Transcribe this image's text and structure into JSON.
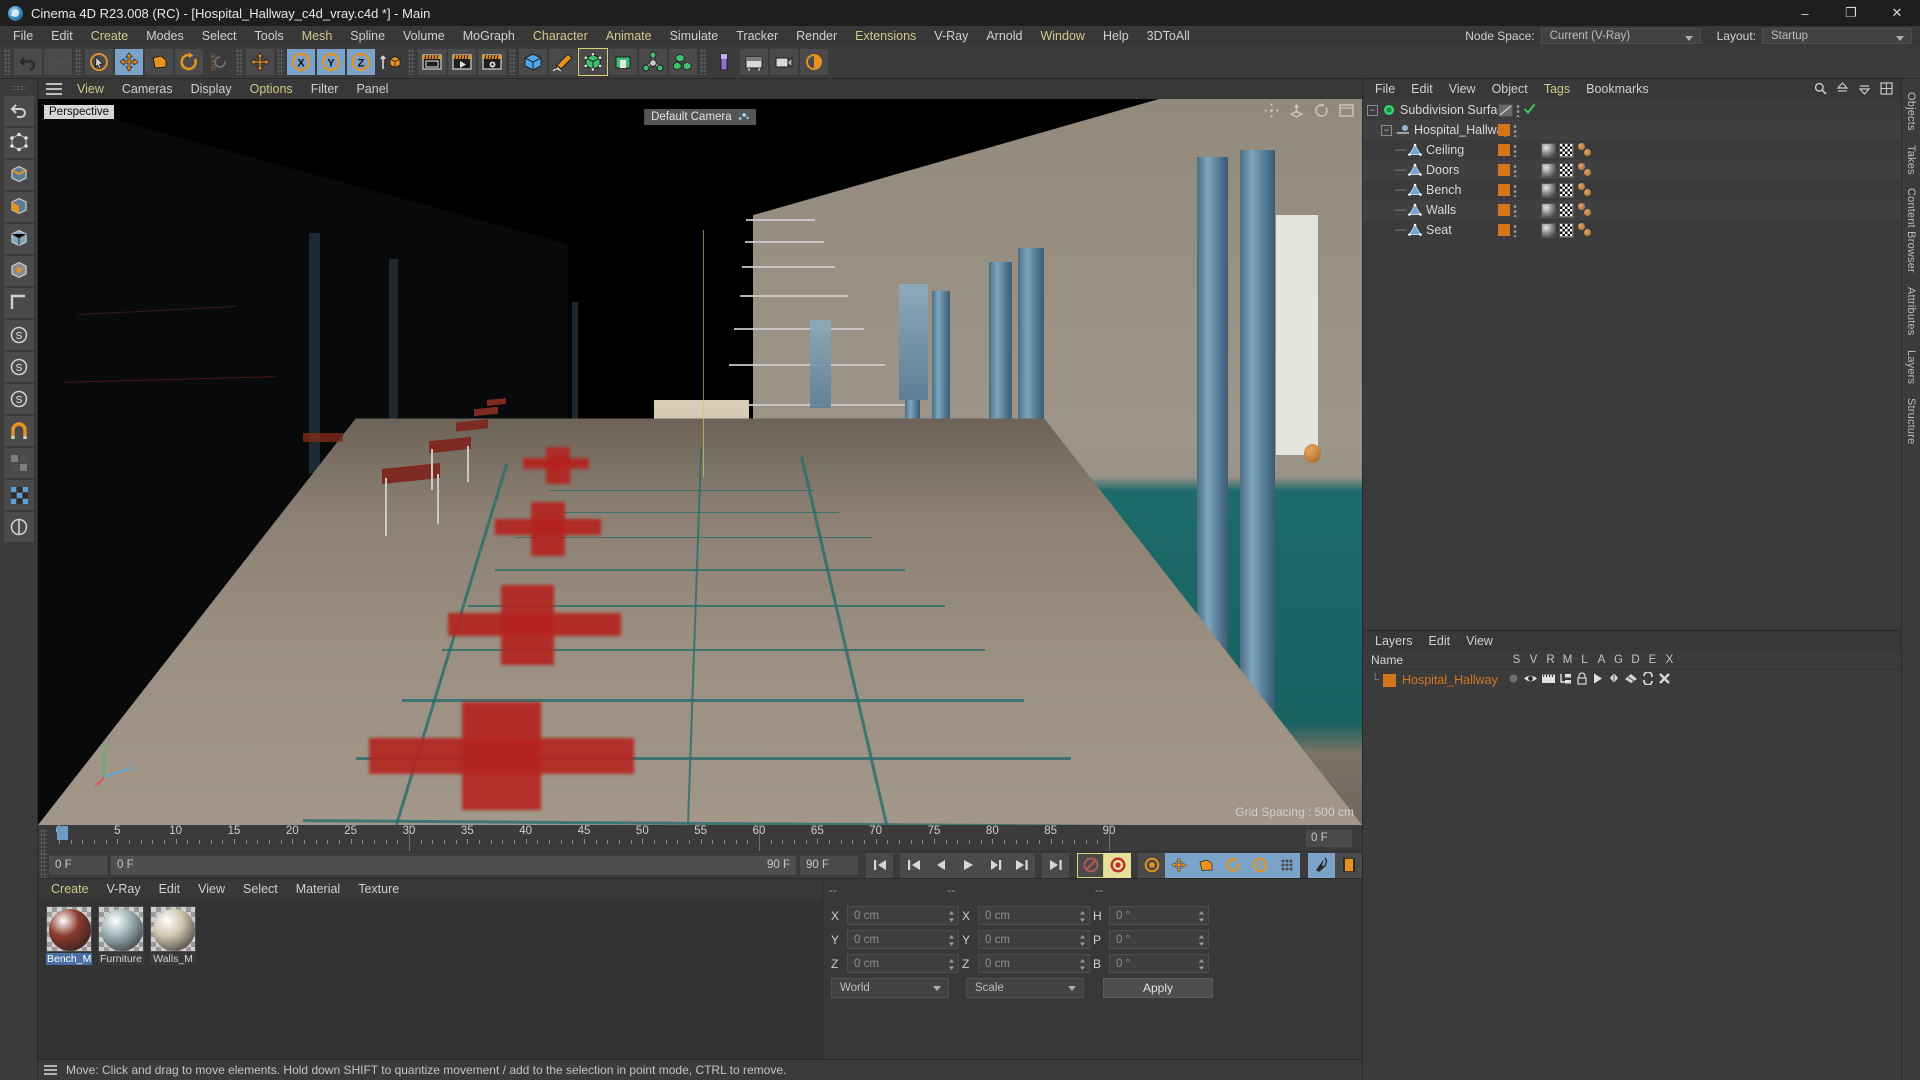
{
  "titlebar": {
    "title": "Cinema 4D R23.008 (RC) - [Hospital_Hallway_c4d_vray.c4d *] - Main",
    "minimize": "–",
    "maximize": "❐",
    "close": "✕"
  },
  "menubar": {
    "items": [
      {
        "label": "File",
        "accent": false
      },
      {
        "label": "Edit",
        "accent": false
      },
      {
        "label": "Create",
        "accent": true
      },
      {
        "label": "Modes",
        "accent": false
      },
      {
        "label": "Select",
        "accent": false
      },
      {
        "label": "Tools",
        "accent": false
      },
      {
        "label": "Mesh",
        "accent": true
      },
      {
        "label": "Spline",
        "accent": false
      },
      {
        "label": "Volume",
        "accent": false
      },
      {
        "label": "MoGraph",
        "accent": false
      },
      {
        "label": "Character",
        "accent": true
      },
      {
        "label": "Animate",
        "accent": true
      },
      {
        "label": "Simulate",
        "accent": false
      },
      {
        "label": "Tracker",
        "accent": false
      },
      {
        "label": "Render",
        "accent": false
      },
      {
        "label": "Extensions",
        "accent": true
      },
      {
        "label": "V-Ray",
        "accent": false
      },
      {
        "label": "Arnold",
        "accent": false
      },
      {
        "label": "Window",
        "accent": true
      },
      {
        "label": "Help",
        "accent": false
      },
      {
        "label": "3DToAll",
        "accent": false
      }
    ]
  },
  "nodespace": {
    "label": "Node Space:",
    "value": "Current (V-Ray)",
    "layout_label": "Layout:",
    "layout_value": "Startup"
  },
  "toolbar": {
    "icons": [
      "undo-icon",
      "redo-icon",
      "live-selection-icon",
      "move-icon",
      "scale-icon",
      "rotate-icon",
      "psr-icon",
      "move-axis-icon",
      "x-axis-icon",
      "y-axis-icon",
      "z-axis-icon",
      "world-axis-icon",
      "render-view-icon",
      "render-picture-viewer-icon",
      "render-settings-icon",
      "cube-primitive-icon",
      "pen-spline-icon",
      "subdivision-surface-icon",
      "array-generator-icon",
      "cloner-icon",
      "mograph-icon",
      "deformer-icon",
      "light-icon",
      "camera-icon",
      "floor-icon"
    ]
  },
  "leftbar": {
    "icons": [
      "undo-tool-icon",
      "point-mode-icon",
      "edge-mode-icon",
      "polygon-mode-icon",
      "model-mode-icon",
      "object-mode-icon",
      "texture-axis-icon",
      "enable-axis-icon",
      "workplane-icon",
      "snap-s-icon",
      "snap-s2-icon",
      "snap-s3-icon",
      "magnet-icon",
      "viewport-solo-icon",
      "grid-icon",
      "workplane-lock-icon"
    ]
  },
  "viewport": {
    "menu": [
      {
        "label": "View",
        "accent": true
      },
      {
        "label": "Cameras",
        "accent": false
      },
      {
        "label": "Display",
        "accent": false
      },
      {
        "label": "Options",
        "accent": true
      },
      {
        "label": "Filter",
        "accent": false
      },
      {
        "label": "Panel",
        "accent": false
      }
    ],
    "label": "Perspective",
    "camera": "Default Camera",
    "grid_spacing": "Grid Spacing : 500 cm",
    "axis": {
      "x": "X",
      "y": "Y",
      "z": "Z"
    },
    "nav_icons": [
      "pan-icon",
      "dolly-icon",
      "orbit-icon",
      "maximize-viewport-icon"
    ]
  },
  "timeline": {
    "ticks": [
      "0",
      "5",
      "10",
      "15",
      "20",
      "25",
      "30",
      "35",
      "40",
      "45",
      "50",
      "55",
      "60",
      "65",
      "70",
      "75",
      "80",
      "85",
      "90"
    ],
    "current_frame_right": "0 F",
    "playhead_frame": 0,
    "range_start": 0,
    "range_end": 90
  },
  "transport": {
    "current_frame": "0 F",
    "preview_start": "0 F",
    "preview_end": "90 F",
    "end_frame": "90 F",
    "buttons": [
      "go-to-start-icon",
      "go-to-previous-key-icon",
      "step-back-icon",
      "play-icon",
      "step-forward-icon",
      "go-to-next-key-icon",
      "go-to-end-icon",
      "record-active-objects-icon",
      "autokeying-icon",
      "keyframe-selection-icon",
      "position-key-icon",
      "scale-key-icon",
      "rotation-key-icon",
      "param-key-icon",
      "pla-key-icon",
      "animation-mode-icon",
      "timeline-mode-icon"
    ]
  },
  "material_manager": {
    "menu": [
      {
        "label": "Create",
        "accent": true
      },
      {
        "label": "V-Ray",
        "accent": false
      },
      {
        "label": "Edit",
        "accent": false
      },
      {
        "label": "View",
        "accent": false
      },
      {
        "label": "Select",
        "accent": false
      },
      {
        "label": "Material",
        "accent": false
      },
      {
        "label": "Texture",
        "accent": false
      }
    ],
    "materials": [
      {
        "name": "Bench_M",
        "color": "#8a3a2e",
        "selected": true
      },
      {
        "name": "Furniture",
        "color": "#9fb2b6",
        "selected": false
      },
      {
        "name": "Walls_M",
        "color": "#cfc6ad",
        "selected": false
      }
    ]
  },
  "coordinates": {
    "headers": [
      "--",
      "--",
      "--"
    ],
    "rows": [
      {
        "label1": "X",
        "value1": "0 cm",
        "label2": "X",
        "value2": "0 cm",
        "label3": "H",
        "value3": "0 °"
      },
      {
        "label1": "Y",
        "value1": "0 cm",
        "label2": "Y",
        "value2": "0 cm",
        "label3": "P",
        "value3": "0 °"
      },
      {
        "label1": "Z",
        "value1": "0 cm",
        "label2": "Z",
        "value2": "0 cm",
        "label3": "B",
        "value3": "0 °"
      }
    ],
    "space_select": "World",
    "mode_select": "Scale",
    "apply_label": "Apply"
  },
  "object_manager": {
    "menu": [
      {
        "label": "File",
        "accent": false
      },
      {
        "label": "Edit",
        "accent": false
      },
      {
        "label": "View",
        "accent": false
      },
      {
        "label": "Object",
        "accent": false
      },
      {
        "label": "Tags",
        "accent": true
      },
      {
        "label": "Bookmarks",
        "accent": false
      }
    ],
    "objects": [
      {
        "name": "Subdivision Surface",
        "depth": 0,
        "type": "subdivision-surface",
        "tags": [
          "display",
          "dots",
          "check"
        ],
        "has_material": false
      },
      {
        "name": "Hospital_Hallway",
        "depth": 1,
        "type": "null-object",
        "tags": [
          "layer",
          "dots"
        ],
        "has_material": false
      },
      {
        "name": "Ceiling",
        "depth": 2,
        "type": "polygon-object",
        "tags": [
          "layer",
          "dots"
        ],
        "has_material": true
      },
      {
        "name": "Doors",
        "depth": 2,
        "type": "polygon-object",
        "tags": [
          "layer",
          "dots"
        ],
        "has_material": true
      },
      {
        "name": "Bench",
        "depth": 2,
        "type": "polygon-object",
        "tags": [
          "layer",
          "dots"
        ],
        "has_material": true
      },
      {
        "name": "Walls",
        "depth": 2,
        "type": "polygon-object",
        "tags": [
          "layer",
          "dots"
        ],
        "has_material": true
      },
      {
        "name": "Seat",
        "depth": 2,
        "type": "polygon-object",
        "tags": [
          "layer",
          "dots"
        ],
        "has_material": true
      }
    ]
  },
  "layer_manager": {
    "menu": [
      {
        "label": "Layers",
        "accent": false
      },
      {
        "label": "Edit",
        "accent": false
      },
      {
        "label": "View",
        "accent": false
      }
    ],
    "name_header": "Name",
    "columns": [
      "S",
      "V",
      "R",
      "M",
      "L",
      "A",
      "G",
      "D",
      "E",
      "X"
    ],
    "layers": [
      {
        "name": "Hospital_Hallway",
        "color": "#d2761e"
      }
    ]
  },
  "right_rail": {
    "tabs": [
      "Objects",
      "Takes",
      "Content Browser",
      "Attributes",
      "Layers",
      "Structure"
    ]
  },
  "statusbar": {
    "message": "Move: Click and drag to move elements. Hold down SHIFT to quantize movement / add to the selection in point mode, CTRL to remove."
  },
  "colors": {
    "accent_yellow": "#cfc98a",
    "orange_tag": "#d2761e",
    "blue_highlight": "#7ba3c9",
    "panel_bg": "#383838",
    "list_bg": "#3b3b3b"
  }
}
